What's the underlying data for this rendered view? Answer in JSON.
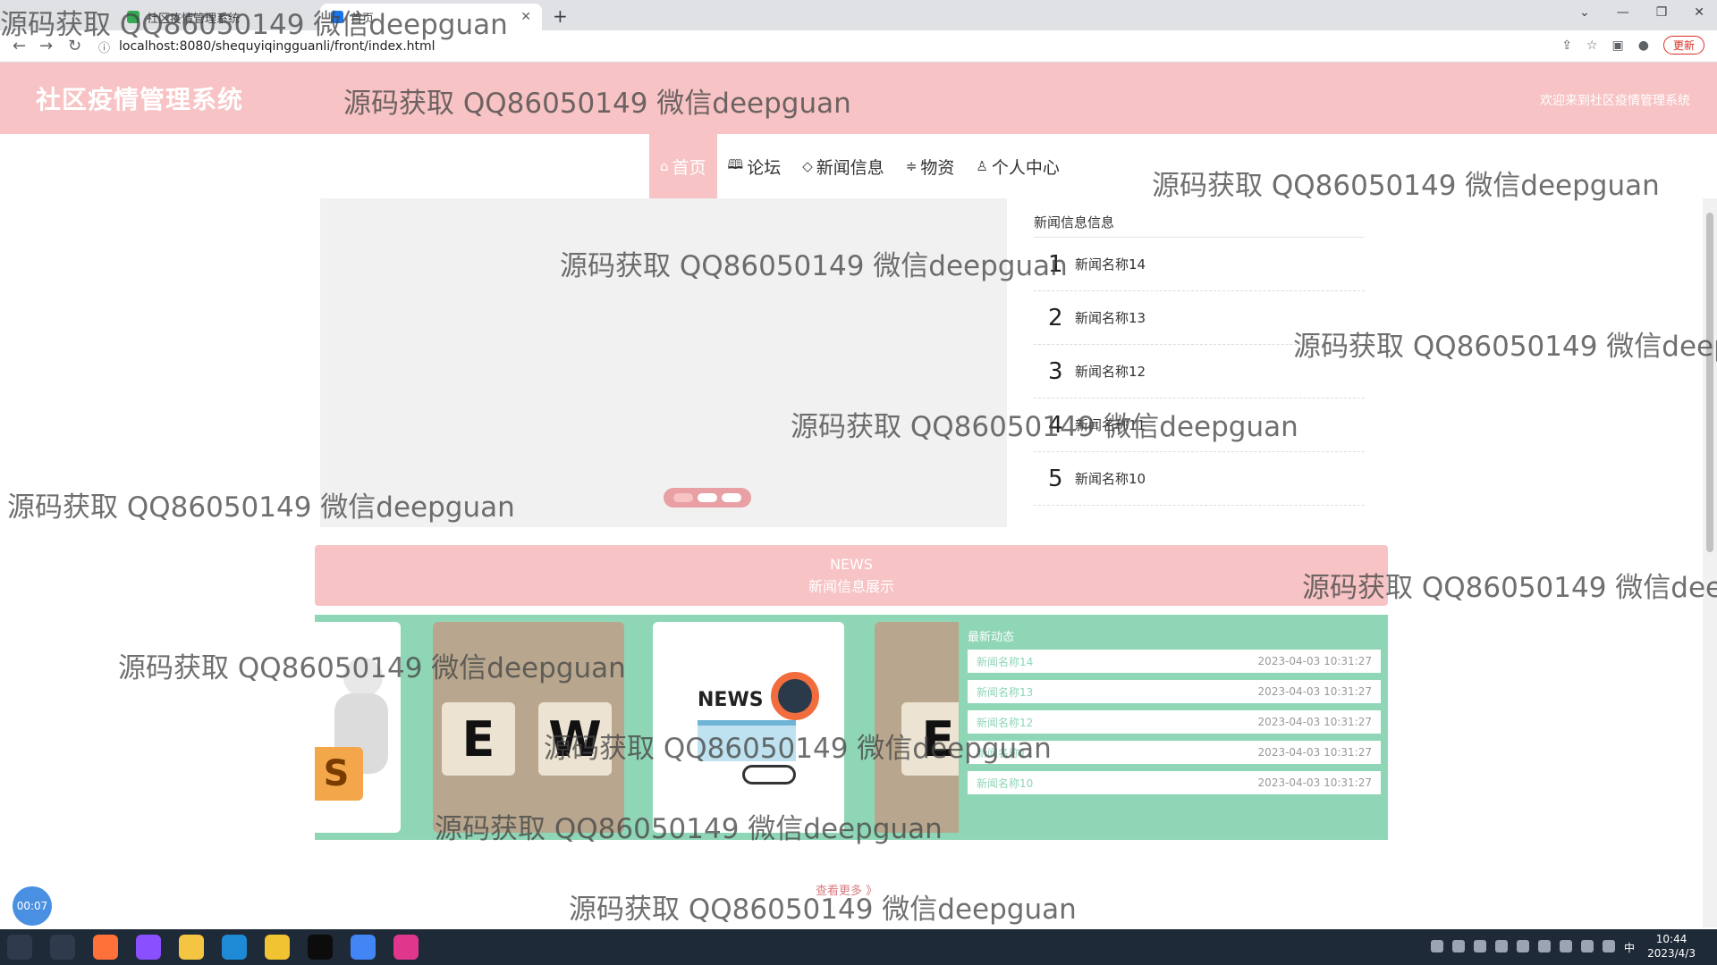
{
  "browser": {
    "tabs": [
      {
        "label": "社区疫情管理系统"
      },
      {
        "label": "首页"
      }
    ],
    "url": "localhost:8080/shequyiqingguanli/front/index.html",
    "update_label": "更新"
  },
  "site": {
    "title": "社区疫情管理系统",
    "welcome": "欢迎来到社区疫情管理系统"
  },
  "nav": [
    {
      "label": "首页",
      "icon": "home-icon",
      "active": true
    },
    {
      "label": "论坛",
      "icon": "book-icon"
    },
    {
      "label": "新闻信息",
      "icon": "tag-icon"
    },
    {
      "label": "物资",
      "icon": "sliders-icon"
    },
    {
      "label": "个人中心",
      "icon": "user-icon"
    }
  ],
  "carousel": {
    "slide_count": 3,
    "active_index": 0
  },
  "news_panel": {
    "title": "新闻信息信息",
    "items": [
      {
        "num": "1",
        "name": "新闻名称14"
      },
      {
        "num": "2",
        "name": "新闻名称13"
      },
      {
        "num": "3",
        "name": "新闻名称12"
      },
      {
        "num": "4",
        "name": "新闻名称11"
      },
      {
        "num": "5",
        "name": "新闻名称10"
      }
    ]
  },
  "news_banner": {
    "en": "NEWS",
    "cn": "新闻信息展示"
  },
  "latest": {
    "title": "最新动态",
    "items": [
      {
        "title": "新闻名称14",
        "date": "2023-04-03 10:31:27"
      },
      {
        "title": "新闻名称13",
        "date": "2023-04-03 10:31:27"
      },
      {
        "title": "新闻名称12",
        "date": "2023-04-03 10:31:27"
      },
      {
        "title": "新闻名称11",
        "date": "2023-04-03 10:31:27"
      },
      {
        "title": "新闻名称10",
        "date": "2023-04-03 10:31:27"
      }
    ]
  },
  "thumb_text": {
    "t2": "E W",
    "t4": "E",
    "t3": "NEWS",
    "t1": "S"
  },
  "more_label": "查看更多 》",
  "recorder": {
    "time": "00:07"
  },
  "taskbar": {
    "time": "10:44",
    "date": "2023/4/3",
    "ime": "中"
  },
  "watermark": "源码获取 QQ86050149 微信deepguan",
  "colors": {
    "brand_pink": "#f7c3c5",
    "mint": "#8fd6b6"
  }
}
